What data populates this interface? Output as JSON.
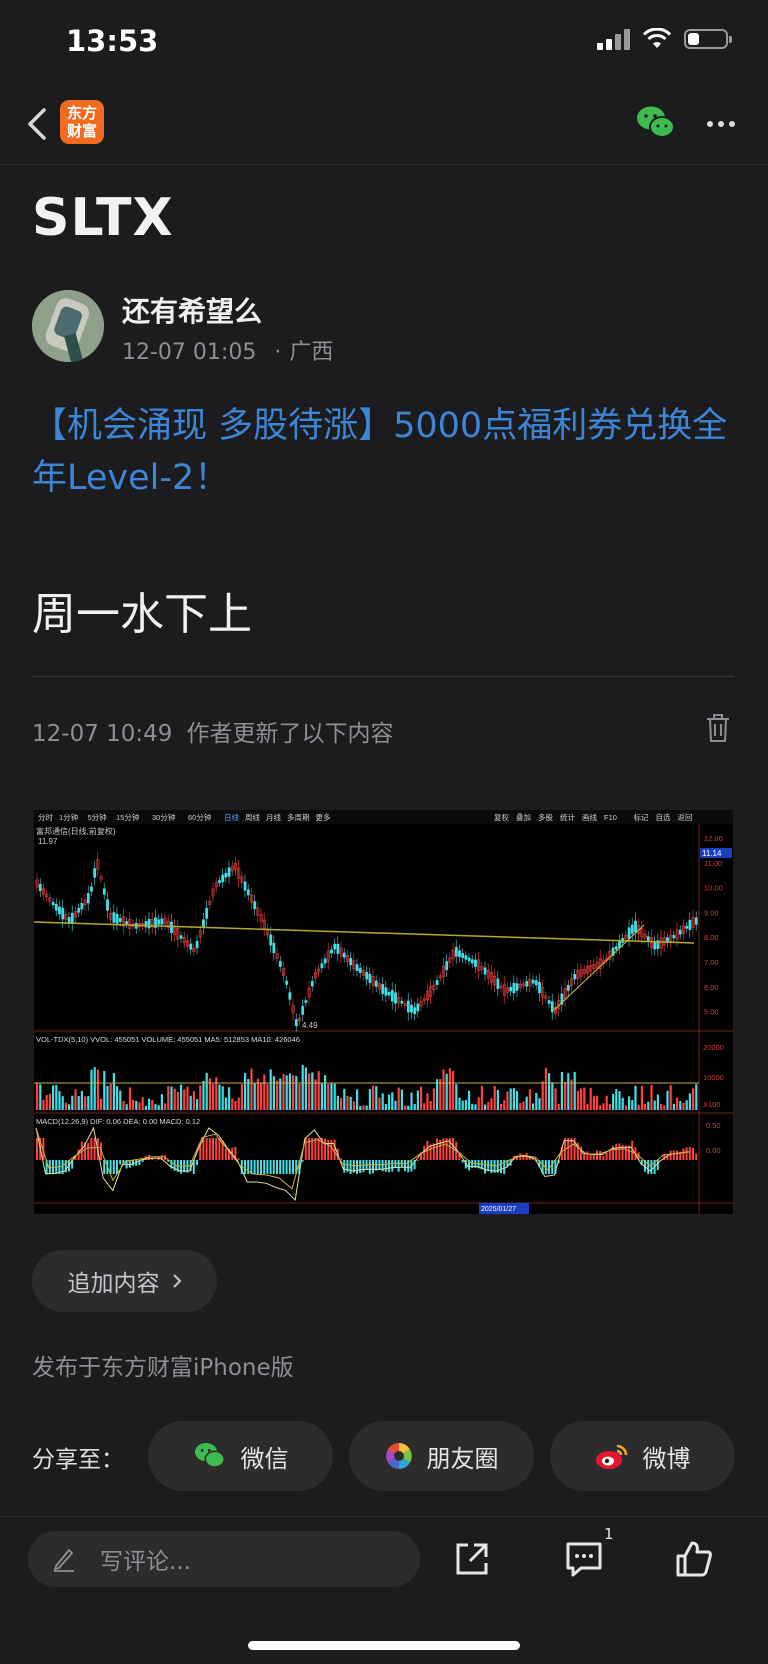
{
  "status_bar": {
    "time": "13:53",
    "battery_level": 0.3
  },
  "nav": {
    "logo_text": "东方\n财富",
    "icons": [
      "back-icon",
      "wechat-icon",
      "more-icon"
    ]
  },
  "post": {
    "title": "SLTX",
    "author": "还有希望么",
    "date": "12-07 01:05",
    "location": "广西",
    "promo_link": "【机会涌现 多股待涨】5000点福利券兑换全年Level-2！",
    "body": "周一水下上",
    "update_date": "12-07 10:49",
    "update_text": "作者更新了以下内容"
  },
  "chart_image": {
    "period_tabs": [
      "分时",
      "1分钟",
      "5分钟",
      "15分钟",
      "30分钟",
      "60分钟",
      "日线",
      "周线",
      "月线",
      "多周期",
      "更多"
    ],
    "right_tabs": [
      "复权",
      "叠加",
      "多股",
      "统计",
      "画线",
      "F10",
      "标记",
      "自选",
      "返回"
    ],
    "stock_label": "富邦通信(日线,前复权)",
    "price_high": "11.97",
    "price_low": "4.49",
    "current_price": "11.14",
    "price_ticks": [
      "12.00",
      "11.00",
      "10.00",
      "9.00",
      "8.00",
      "7.00",
      "6.00",
      "5.00"
    ],
    "volume_label": "VOL-TDX(5,10)  VVOL: 455051  VOLUME: 455051  MA5: 512853  MA10: 426046",
    "volume_ticks": [
      "20000",
      "10000",
      "X100"
    ],
    "macd_label": "MACD(12,26,9)  DIF: 0.06  DEA: 0.00  MACD: 0.12",
    "macd_ticks": [
      "0.50",
      "0.00"
    ],
    "date_marker": "2025/01/27"
  },
  "actions": {
    "add_content": "追加内容",
    "published_via": "发布于东方财富iPhone版",
    "share_label": "分享至：",
    "share_wechat": "微信",
    "share_moments": "朋友圈",
    "share_weibo": "微博"
  },
  "bottom_bar": {
    "comment_placeholder": "写评论...",
    "comment_count": "1"
  },
  "colors": {
    "accent_link": "#3b86d6",
    "background": "#1c1c1e",
    "brand": "#f26b21",
    "wechat_green": "#3dbb4e"
  }
}
